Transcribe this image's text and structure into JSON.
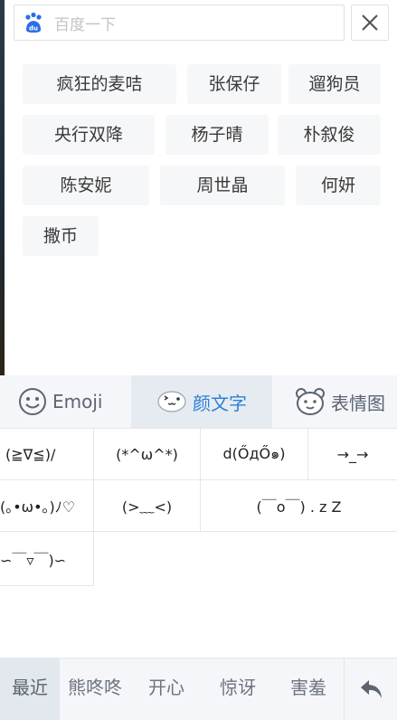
{
  "search": {
    "placeholder": "百度一下"
  },
  "hot_searches": [
    "疯狂的麦咭",
    "张保仔",
    "遛狗员",
    "央行双降",
    "杨子晴",
    "朴叙俊",
    "陈安妮",
    "周世晶",
    "何妍",
    "撒币"
  ],
  "keyboard_tabs": [
    {
      "label": "Emoji",
      "icon": "emoji-face-icon",
      "active": false
    },
    {
      "label": "颜文字",
      "icon": "kaomoji-icon",
      "active": true
    },
    {
      "label": "表情图",
      "icon": "bear-sticker-icon",
      "active": false
    }
  ],
  "kaomoji": [
    "(≧∇≦)/",
    "(*^ω^*)",
    "d(ŐдŐ๑)",
    "→_→",
    "(｡•ω•｡)ﾉ♡",
    "(>﹏<)",
    "(￣o￣) . z Z",
    "∽￣▿￣)∽"
  ],
  "categories": [
    {
      "label": "最近",
      "active": true
    },
    {
      "label": "熊咚咚",
      "active": false
    },
    {
      "label": "开心",
      "active": false
    },
    {
      "label": "惊讶",
      "active": false
    },
    {
      "label": "害羞",
      "active": false
    }
  ],
  "colors": {
    "accent": "#2c80d6",
    "baidu_blue": "#2b6de5"
  }
}
